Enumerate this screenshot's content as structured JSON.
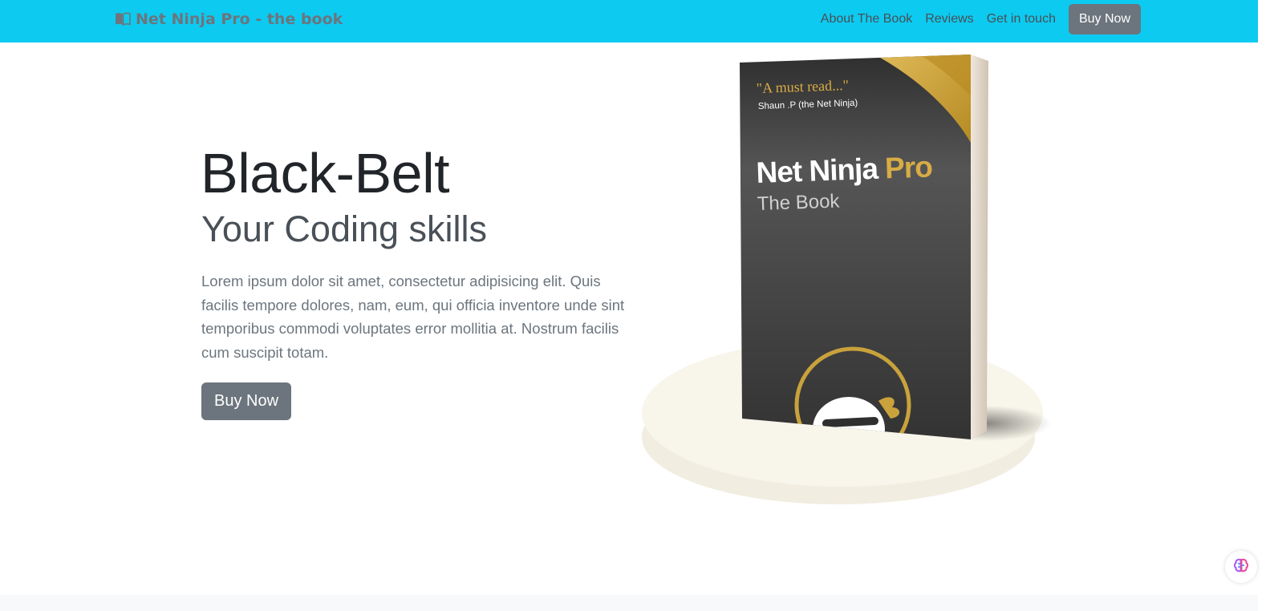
{
  "nav": {
    "brand": "Net Ninja Pro - the book",
    "brand_icon": "book-icon",
    "links": [
      "About The Book",
      "Reviews",
      "Get in touch"
    ],
    "cta": "Buy Now"
  },
  "hero": {
    "title": "Black-Belt",
    "subtitle": "Your Coding skills",
    "text": "Lorem ipsum dolor sit amet, consectetur adipisicing elit. Quis facilis tempore dolores, nam, eum, qui officia inventore unde sint temporibus commodi voluptates error mollitia at. Nostrum facilis cum suscipit totam.",
    "button": "Buy Now"
  },
  "book": {
    "quote": "\"A must read...\"",
    "quote_author": "Shaun .P (the Net Ninja)",
    "title_a": "Net Ninja",
    "title_b": "Pro",
    "subtitle": "The Book"
  },
  "widget_icon": "brain-icon",
  "colors": {
    "navbar": "#0dcaf0",
    "button": "#6c757d",
    "gold": "#c9a23c",
    "book_dark": "#3a3a3a"
  }
}
